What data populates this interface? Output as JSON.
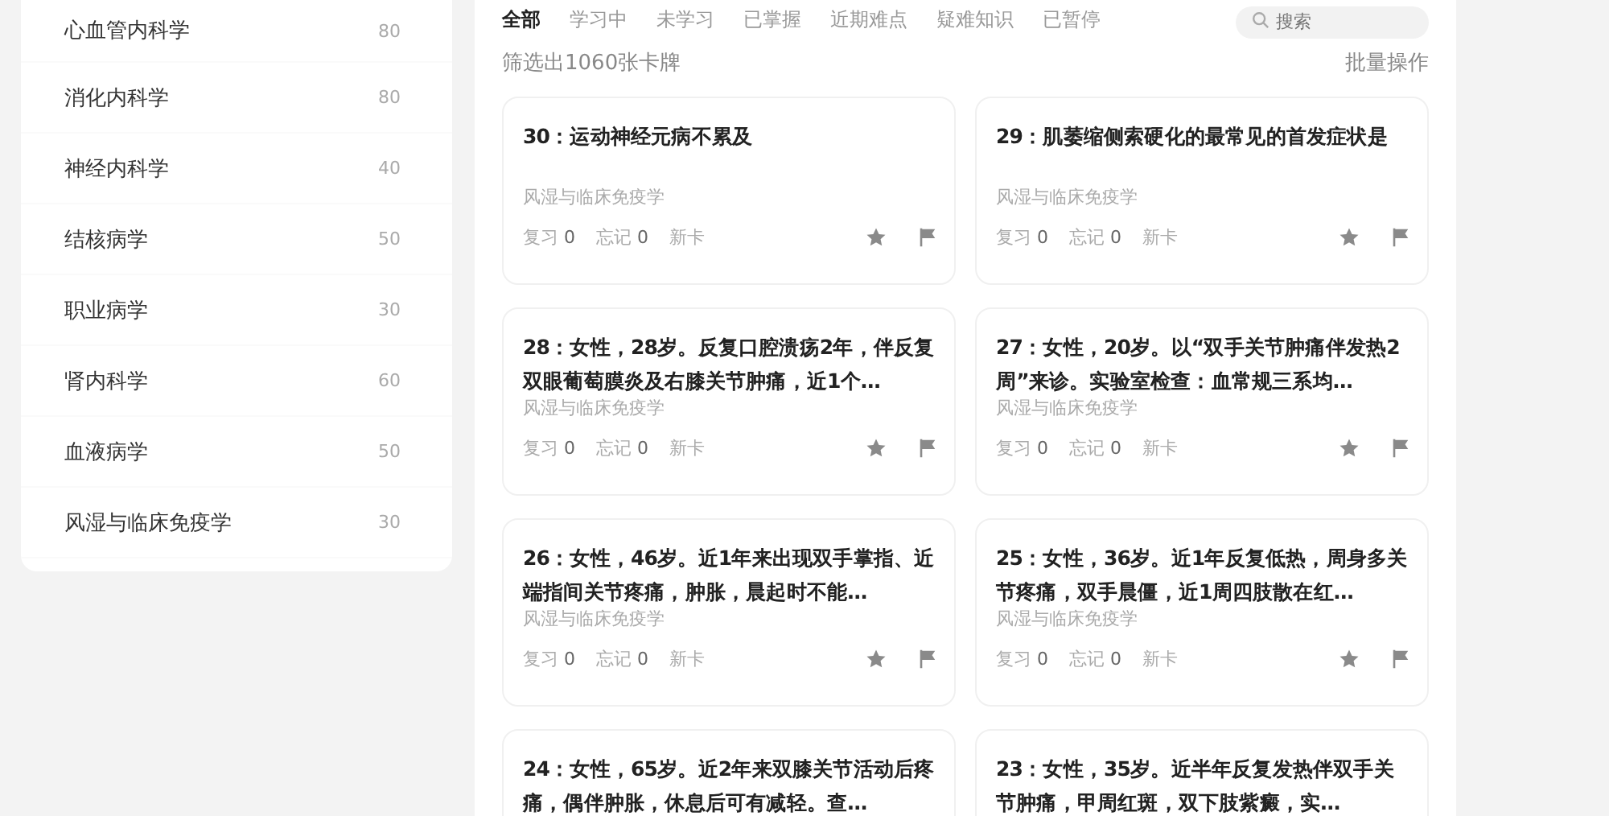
{
  "sidebar": {
    "items": [
      {
        "name": "心血管内科学",
        "count": "80"
      },
      {
        "name": "消化内科学",
        "count": "80"
      },
      {
        "name": "神经内科学",
        "count": "40"
      },
      {
        "name": "结核病学",
        "count": "50"
      },
      {
        "name": "职业病学",
        "count": "30"
      },
      {
        "name": "肾内科学",
        "count": "60"
      },
      {
        "name": "血液病学",
        "count": "50"
      },
      {
        "name": "风湿与临床免疫学",
        "count": "30"
      }
    ]
  },
  "tabs": [
    {
      "label": "全部",
      "selected": true
    },
    {
      "label": "学习中",
      "selected": false
    },
    {
      "label": "未学习",
      "selected": false
    },
    {
      "label": "已掌握",
      "selected": false
    },
    {
      "label": "近期难点",
      "selected": false
    },
    {
      "label": "疑难知识",
      "selected": false
    },
    {
      "label": "已暂停",
      "selected": false
    }
  ],
  "search": {
    "placeholder": "搜索"
  },
  "filter_summary": "筛选出1060张卡牌",
  "batch_action": "批量操作",
  "cards": [
    {
      "title": "30：运动神经元病不累及",
      "subject": "风湿与临床免疫学",
      "stats": [
        {
          "label": "复习",
          "value": "0"
        },
        {
          "label": "忘记",
          "value": "0"
        }
      ],
      "status": "新卡"
    },
    {
      "title": "29：肌萎缩侧索硬化的最常见的首发症状是",
      "subject": "风湿与临床免疫学",
      "stats": [
        {
          "label": "复习",
          "value": "0"
        },
        {
          "label": "忘记",
          "value": "0"
        }
      ],
      "status": "新卡"
    },
    {
      "title": "28：女性，28岁。反复口腔溃疡2年，伴反复双眼葡萄膜炎及右膝关节肿痛，近1个…",
      "subject": "风湿与临床免疫学",
      "stats": [
        {
          "label": "复习",
          "value": "0"
        },
        {
          "label": "忘记",
          "value": "0"
        }
      ],
      "status": "新卡"
    },
    {
      "title": "27：女性，20岁。以“双手关节肿痛伴发热2周”来诊。实验室检查：血常规三系均…",
      "subject": "风湿与临床免疫学",
      "stats": [
        {
          "label": "复习",
          "value": "0"
        },
        {
          "label": "忘记",
          "value": "0"
        }
      ],
      "status": "新卡"
    },
    {
      "title": "26：女性，46岁。近1年来出现双手掌指、近端指间关节疼痛，肿胀，晨起时不能…",
      "subject": "风湿与临床免疫学",
      "stats": [
        {
          "label": "复习",
          "value": "0"
        },
        {
          "label": "忘记",
          "value": "0"
        }
      ],
      "status": "新卡"
    },
    {
      "title": "25：女性，36岁。近1年反复低热，周身多关节疼痛，双手晨僵，近1周四肢散在红…",
      "subject": "风湿与临床免疫学",
      "stats": [
        {
          "label": "复习",
          "value": "0"
        },
        {
          "label": "忘记",
          "value": "0"
        }
      ],
      "status": "新卡"
    },
    {
      "title": "24：女性，65岁。近2年来双膝关节活动后疼痛，偶伴肿胀，休息后可有减轻。查…"
    },
    {
      "title": "23：女性，35岁。近半年反复发热伴双手关节肿痛，甲周红斑，双下肢紫癜，实…"
    }
  ]
}
